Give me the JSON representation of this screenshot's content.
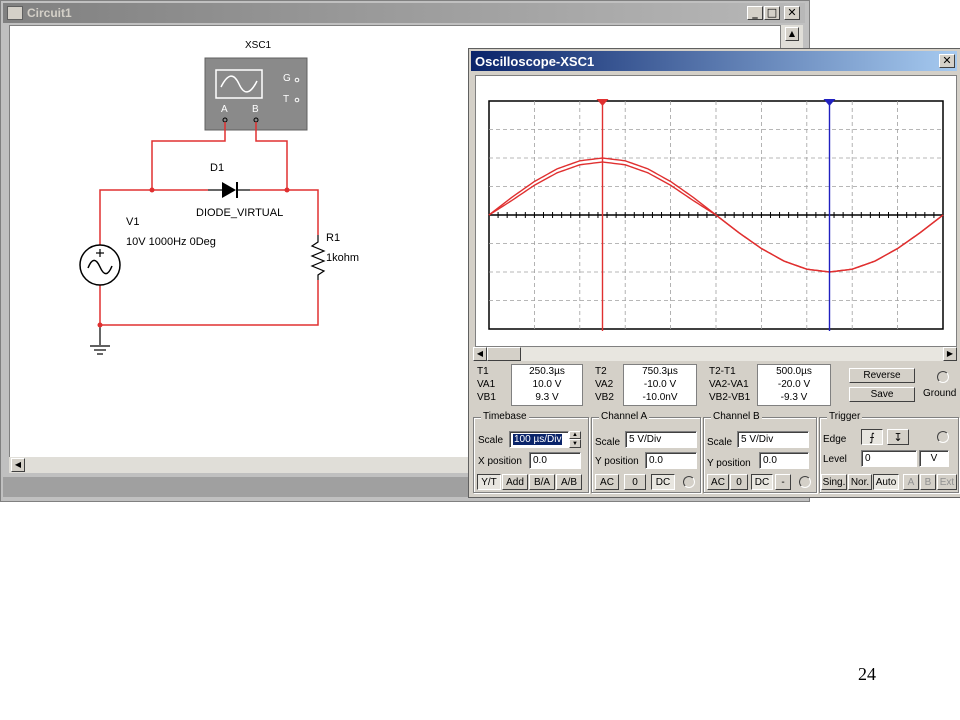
{
  "circuit_window": {
    "title": "Circuit1",
    "title_buttons": [
      "_",
      "□",
      "✕"
    ]
  },
  "schematic": {
    "scope_ref": "XSC1",
    "scope_terminals": {
      "g": "G",
      "t": "T",
      "a": "A",
      "b": "B"
    },
    "diode_ref": "D1",
    "diode_model": "DIODE_VIRTUAL",
    "source_ref": "V1",
    "source_value": "10V 1000Hz 0Deg",
    "resistor_ref": "R1",
    "resistor_value": "1kohm",
    "wire_color": "#e03030"
  },
  "scope_window": {
    "title": "Oscilloscope-XSC1",
    "close_label": "✕",
    "screen": {
      "divisions_x": 10,
      "divisions_y": 8,
      "channel_a_color": "#e03030",
      "cursor1_color": "#e03030",
      "cursor2_color": "#2020c0",
      "cursor1_fraction": 0.25,
      "cursor2_fraction": 0.75
    },
    "measurements": {
      "t1": {
        "label": "T1",
        "time": "250.3µs",
        "va_label": "VA1",
        "va": "10.0 V",
        "vb_label": "VB1",
        "vb": "9.3 V"
      },
      "t2": {
        "label": "T2",
        "time": "750.3µs",
        "va_label": "VA2",
        "va": "-10.0 V",
        "vb_label": "VB2",
        "vb": "-10.0nV"
      },
      "diff": {
        "label": "T2-T1",
        "time": "500.0µs",
        "va_label": "VA2-VA1",
        "va": "-20.0 V",
        "vb_label": "VB2-VB1",
        "vb": "-9.3 V"
      }
    },
    "reverse_label": "Reverse",
    "save_label": "Save",
    "ground_label": "Ground",
    "timebase": {
      "title": "Timebase",
      "scale_label": "Scale",
      "scale_value": "100 µs/Div",
      "xpos_label": "X position",
      "xpos_value": "0.0",
      "modes": [
        "Y/T",
        "Add",
        "B/A",
        "A/B"
      ]
    },
    "channel_a": {
      "title": "Channel A",
      "scale_label": "Scale",
      "scale_value": "5 V/Div",
      "ypos_label": "Y position",
      "ypos_value": "0.0",
      "coupling": [
        "AC",
        "0",
        "DC"
      ]
    },
    "channel_b": {
      "title": "Channel B",
      "scale_label": "Scale",
      "scale_value": "5 V/Div",
      "ypos_label": "Y position",
      "ypos_value": "0.0",
      "coupling": [
        "AC",
        "0",
        "DC",
        "-"
      ]
    },
    "trigger": {
      "title": "Trigger",
      "edge_label": "Edge",
      "level_label": "Level",
      "level_value": "0",
      "level_unit": "V",
      "modes": [
        "Sing.",
        "Nor.",
        "Auto"
      ],
      "sources": [
        "A",
        "B",
        "Ext"
      ]
    }
  },
  "chart_data": {
    "type": "line",
    "x": [
      0,
      50,
      100,
      150,
      200,
      250,
      300,
      350,
      400,
      450,
      500,
      550,
      600,
      650,
      700,
      750,
      800,
      850,
      900,
      950,
      1000
    ],
    "series": [
      {
        "values": [
          0,
          3.09,
          5.88,
          8.09,
          9.51,
          10.0,
          9.51,
          8.09,
          5.88,
          3.09,
          0,
          -3.09,
          -5.88,
          -8.09,
          -9.51,
          -10.0,
          -9.51,
          -8.09,
          -5.88,
          -3.09,
          0
        ]
      },
      {
        "values": [
          0,
          2.53,
          5.22,
          7.4,
          8.81,
          9.3,
          8.81,
          7.4,
          5.22,
          2.53,
          0,
          -3.09,
          -5.88,
          -8.09,
          -9.51,
          -10.0,
          -9.51,
          -8.09,
          -5.88,
          -3.09,
          0
        ]
      }
    ],
    "xlim": [
      0,
      1000
    ],
    "ylim": [
      -20,
      20
    ],
    "grid": true
  },
  "slide_number": "24"
}
